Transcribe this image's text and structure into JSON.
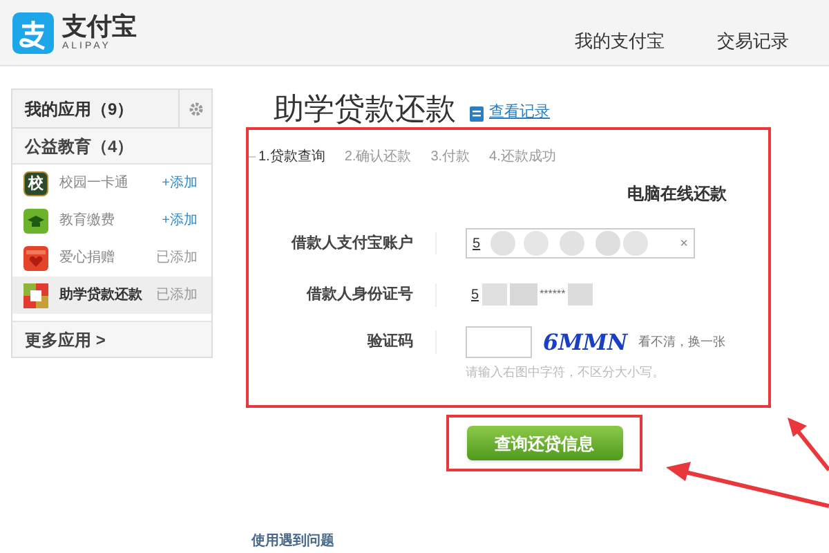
{
  "header": {
    "logo_text": "支付宝",
    "logo_sub": "ALIPAY",
    "nav": [
      "我的支付宝",
      "交易记录"
    ]
  },
  "sidebar": {
    "title": "我的应用（9）",
    "section": "公益教育（4）",
    "items": [
      {
        "kind": "school",
        "badge": "校",
        "label": "校园一卡通",
        "action": "+添加",
        "added": false,
        "selected": false
      },
      {
        "kind": "cap",
        "label": "教育缴费",
        "action": "+添加",
        "added": false,
        "selected": false
      },
      {
        "kind": "heart",
        "label": "爱心捐赠",
        "action": "已添加",
        "added": true,
        "selected": false
      },
      {
        "kind": "loan",
        "label": "助学贷款还款",
        "action": "已添加",
        "added": true,
        "selected": true
      }
    ],
    "more": "更多应用 >"
  },
  "page": {
    "title": "助学贷款还款",
    "records_link": "查看记录",
    "steps": [
      {
        "label": "1.贷款查询",
        "selected": true
      },
      {
        "label": "2.确认还款",
        "selected": false
      },
      {
        "label": "3.付款",
        "selected": false
      },
      {
        "label": "4.还款成功",
        "selected": false
      }
    ],
    "form_title": "电脑在线还款",
    "account": {
      "label": "借款人支付宝账户",
      "value": "5",
      "clear": "×"
    },
    "id_number": {
      "label": "借款人身份证号",
      "value": "5",
      "masked": "******"
    },
    "captcha": {
      "label": "验证码",
      "code": "6MMN",
      "refresh": "看不清，换一张",
      "hint": "请输入右图中字符，不区分大小写。"
    },
    "submit": "查询还贷信息",
    "help": "使用遇到问题"
  }
}
